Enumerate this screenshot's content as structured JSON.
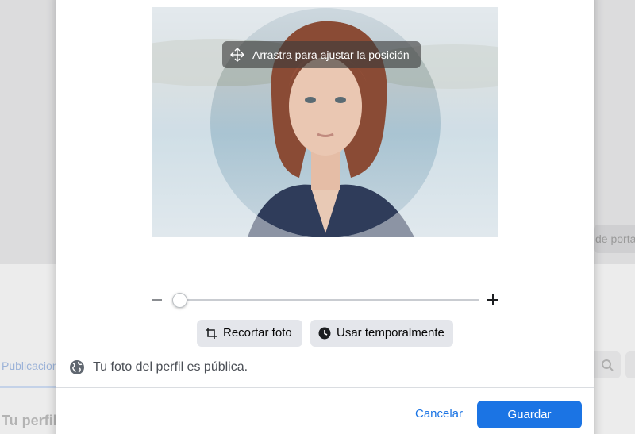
{
  "background": {
    "cover_button_label": "de porta",
    "tab_label": "Publicaciones",
    "section_title": "Tu perfil"
  },
  "dialog": {
    "drag_hint": "Arrastra para ajustar la posición",
    "zoom": {
      "level": 0.0,
      "minus_icon": "minus-icon",
      "plus_icon": "plus-icon"
    },
    "buttons": {
      "crop_label": "Recortar foto",
      "crop_icon": "crop-icon",
      "temporary_label": "Usar temporalmente",
      "temporary_icon": "clock-icon"
    },
    "privacy": {
      "icon": "globe-icon",
      "text": "Tu foto del perfil es pública."
    },
    "footer": {
      "cancel_label": "Cancelar",
      "save_label": "Guardar"
    }
  },
  "colors": {
    "primary": "#1b74e4",
    "secondary_button_bg": "#e4e6eb",
    "divider": "#dadde1",
    "slider_track": "#c9ccd1"
  }
}
